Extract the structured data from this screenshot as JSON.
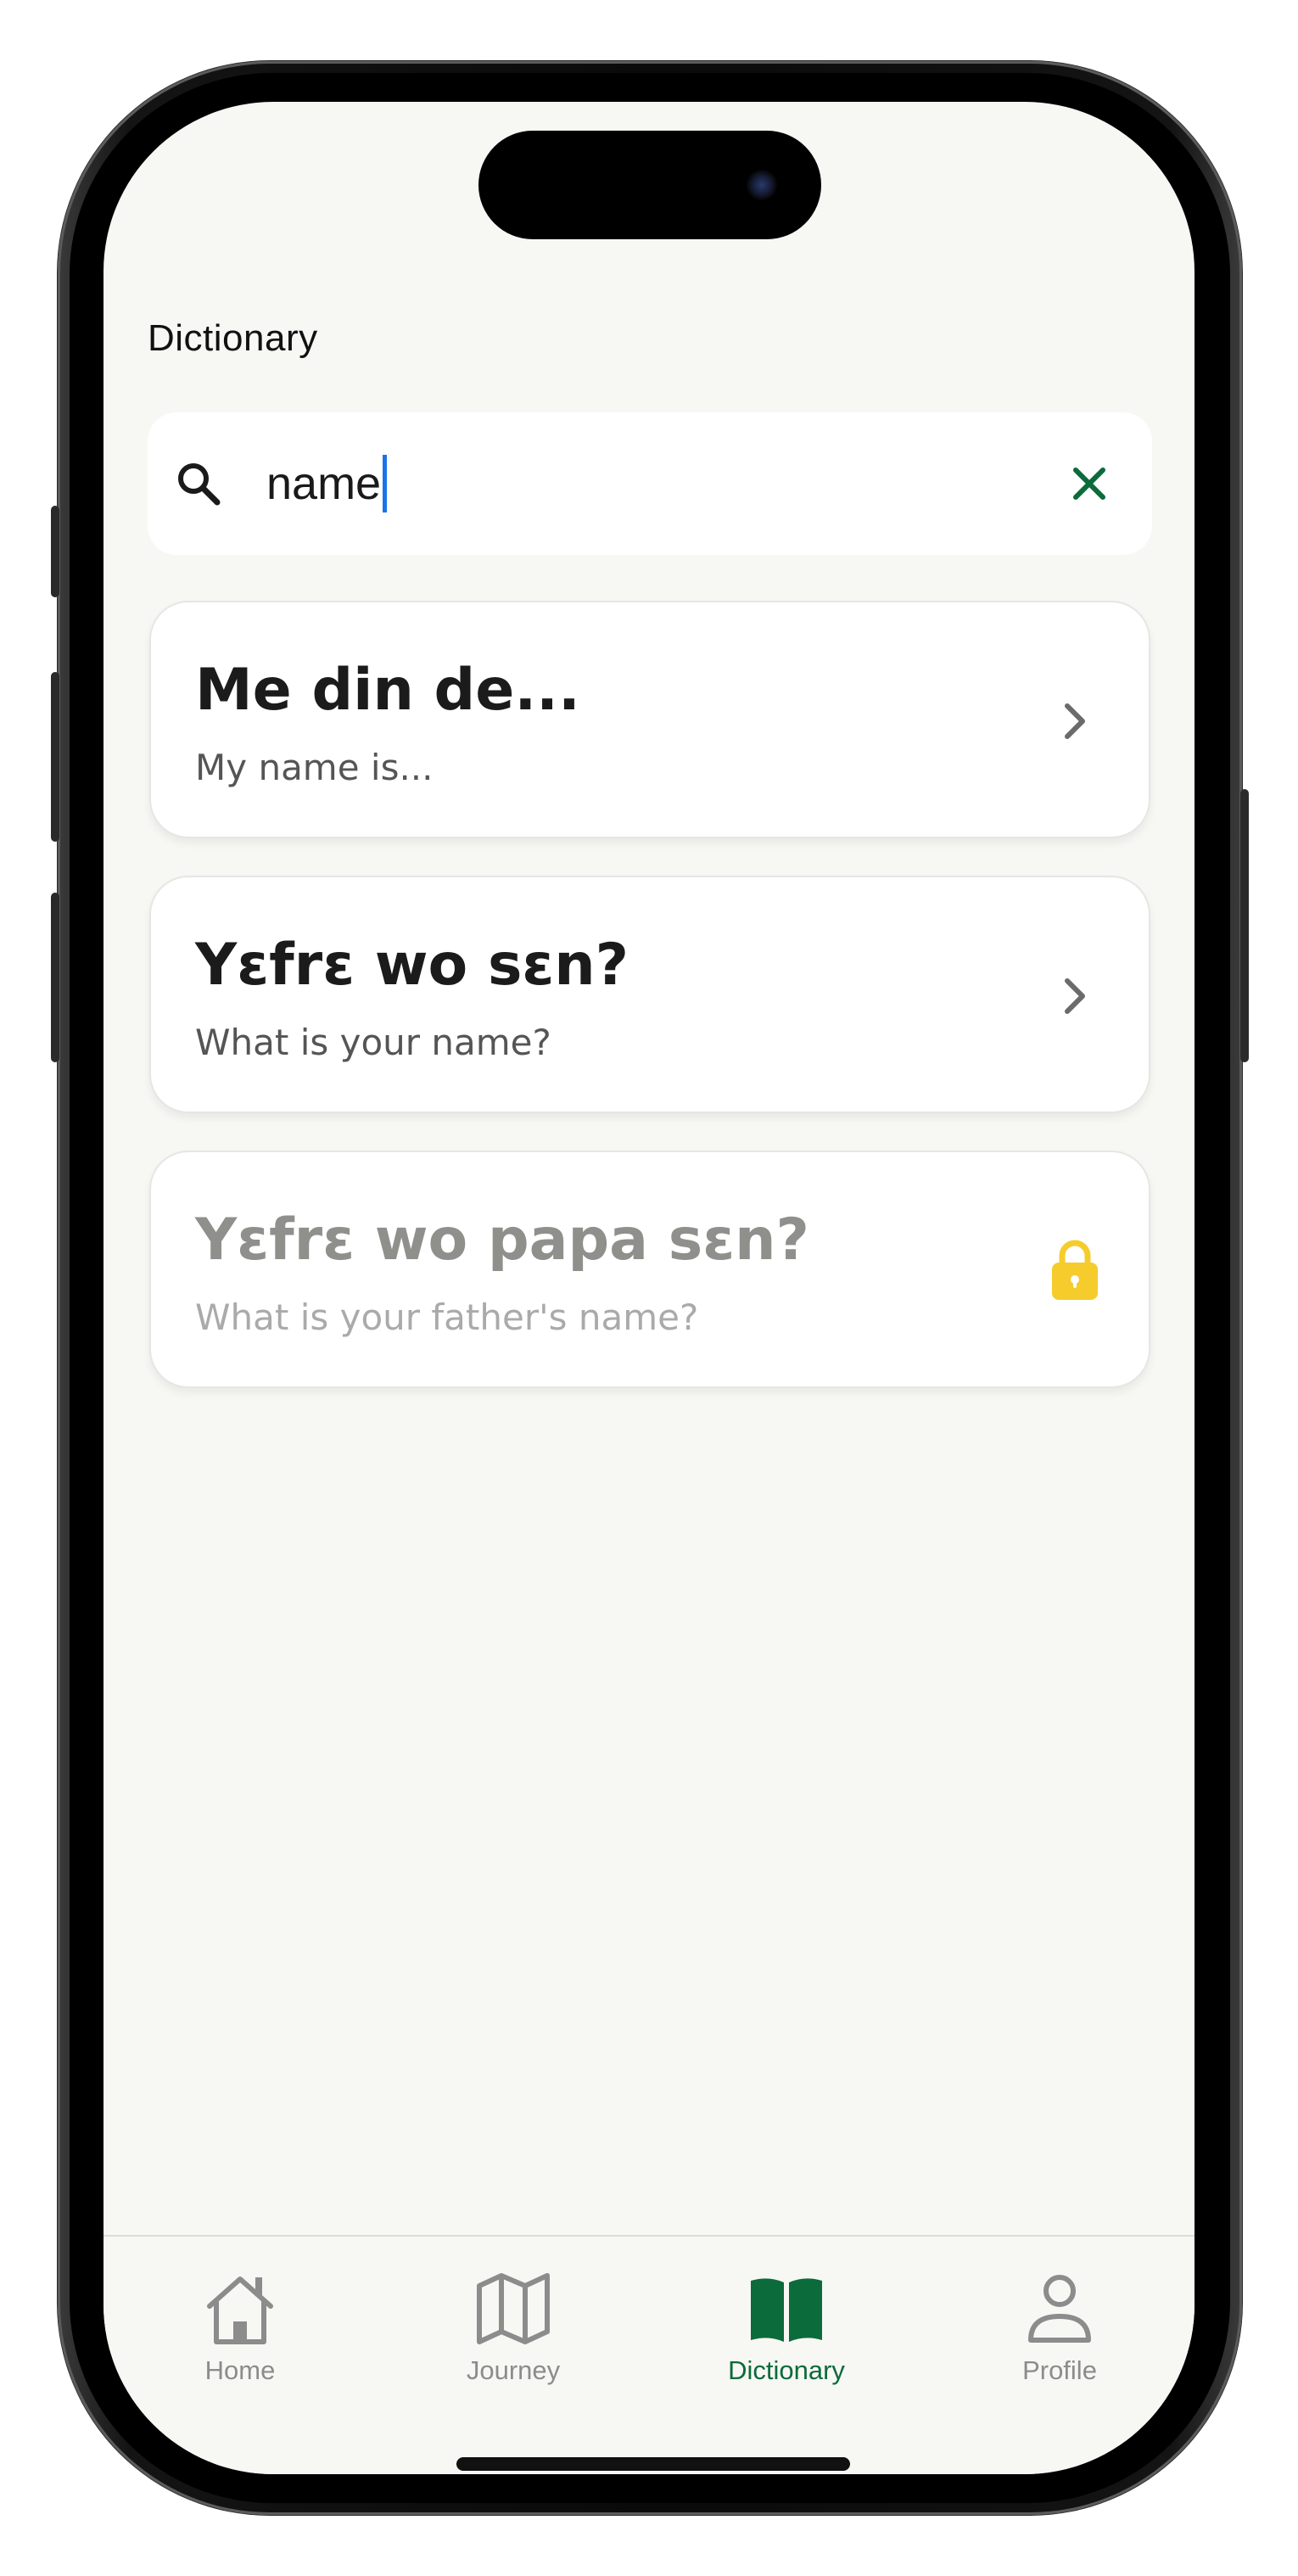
{
  "screen": {
    "title": "Dictionary"
  },
  "search": {
    "value": "name",
    "placeholder": ""
  },
  "results": [
    {
      "phrase": "Me din de...",
      "translation": "My name is...",
      "locked": false
    },
    {
      "phrase": "Yɛfrɛ wo sɛn?",
      "translation": "What is your name?",
      "locked": false
    },
    {
      "phrase": "Yɛfrɛ wo papa sɛn?",
      "translation": "What is your father's name?",
      "locked": true
    }
  ],
  "tabs": [
    {
      "label": "Home",
      "icon": "home-icon",
      "active": false
    },
    {
      "label": "Journey",
      "icon": "map-icon",
      "active": false
    },
    {
      "label": "Dictionary",
      "icon": "book-icon",
      "active": true
    },
    {
      "label": "Profile",
      "icon": "person-icon",
      "active": false
    }
  ],
  "colors": {
    "accent_green": "#0b6b3a",
    "lock_yellow": "#f5cc2c",
    "caret_blue": "#1a73e8",
    "background": "#f7f7f4"
  }
}
